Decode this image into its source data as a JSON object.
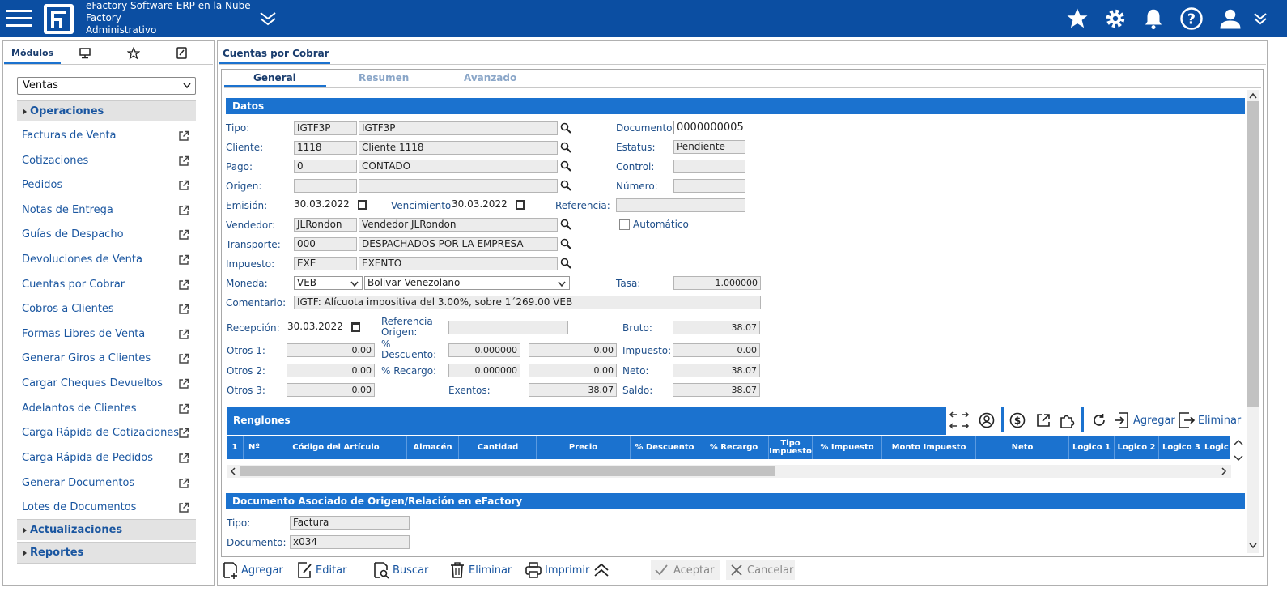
{
  "header": {
    "line1": "eFactory Software ERP en la Nube",
    "line2": "Factory",
    "line3": "Administrativo"
  },
  "sidebar": {
    "tabs": [
      "Módulos"
    ],
    "module_select": "Ventas",
    "sections": [
      "Operaciones",
      "Actualizaciones",
      "Reportes"
    ],
    "items": [
      "Facturas de Venta",
      "Cotizaciones",
      "Pedidos",
      "Notas de Entrega",
      "Guías de Despacho",
      "Devoluciones de Venta",
      "Cuentas por Cobrar",
      "Cobros a Clientes",
      "Formas Libres de Venta",
      "Generar Giros a Clientes",
      "Cargar Cheques Devueltos",
      "Adelantos de Clientes",
      "Carga Rápida de Cotizaciones",
      "Carga Rápida de Pedidos",
      "Generar Documentos",
      "Lotes de Documentos"
    ]
  },
  "main": {
    "window_tab": "Cuentas por Cobrar",
    "subtabs": [
      "General",
      "Resumen",
      "Avanzado"
    ],
    "datos": {
      "title": "Datos",
      "tipo_label": "Tipo:",
      "tipo_code": "IGTF3P",
      "tipo_name": "IGTF3P",
      "cliente_label": "Cliente:",
      "cliente_code": "1118",
      "cliente_name": "Cliente 1118",
      "pago_label": "Pago:",
      "pago_code": "0",
      "pago_name": "CONTADO",
      "origen_label": "Origen:",
      "origen_code": "",
      "origen_name": "",
      "emision_label": "Emisión:",
      "emision": "30.03.2022",
      "vencimiento_label": "Vencimiento:",
      "vencimiento": "30.03.2022",
      "referencia_label": "Referencia:",
      "referencia": "",
      "vendedor_label": "Vendedor:",
      "vendedor_code": "JLRondon",
      "vendedor_name": "Vendedor JLRondon",
      "transporte_label": "Transporte:",
      "transporte_code": "000",
      "transporte_name": "DESPACHADOS POR LA EMPRESA",
      "impuesto_label": "Impuesto:",
      "impuesto_code": "EXE",
      "impuesto_name": "EXENTO",
      "moneda_label": "Moneda:",
      "moneda_code": "VEB",
      "moneda_name": "Bolivar Venezolano",
      "comentario_label": "Comentario:",
      "comentario": "IGTF: Alícuota impositiva del 3.00%, sobre 1´269.00 VEB",
      "documento_label": "Documento:",
      "documento": "0000000005",
      "estatus_label": "Estatus:",
      "estatus": "Pendiente",
      "control_label": "Control:",
      "control": "",
      "numero_label": "Número:",
      "numero": "",
      "automatico_label": "Automático",
      "tasa_label": "Tasa:",
      "tasa": "1.000000",
      "recepcion_label": "Recepción:",
      "recepcion": "30.03.2022",
      "ref_origen_label1": "Referencia",
      "ref_origen_label2": "Origen:",
      "ref_origen": "",
      "otros1_label": "Otros 1:",
      "otros1": "0.00",
      "otros2_label": "Otros 2:",
      "otros2": "0.00",
      "otros3_label": "Otros 3:",
      "otros3": "0.00",
      "descuento_label1": "%",
      "descuento_label2": "Descuento:",
      "descuento_pct": "0.000000",
      "descuento_monto": "0.00",
      "recargo_label": "% Recargo:",
      "recargo_pct": "0.000000",
      "recargo_monto": "0.00",
      "exentos_label": "Exentos:",
      "exentos": "38.07",
      "bruto_label": "Bruto:",
      "bruto": "38.07",
      "impuesto_tot_label": "Impuesto:",
      "impuesto_tot": "0.00",
      "neto_label": "Neto:",
      "neto": "38.07",
      "saldo_label": "Saldo:",
      "saldo": "38.07"
    },
    "renglones": {
      "title": "Renglones",
      "agregar": "Agregar",
      "eliminar": "Eliminar",
      "columns": [
        "1",
        "Nº",
        "Código del Artículo",
        "Almacén",
        "Cantidad",
        "Precio",
        "% Descuento",
        "% Recargo",
        "Tipo Impuesto",
        "% Impuesto",
        "Monto Impuesto",
        "Neto",
        "Logico 1",
        "Logico 2",
        "Logico 3",
        "Logic"
      ]
    },
    "asociado": {
      "title": "Documento Asociado de Origen/Relación en eFactory",
      "tipo_label": "Tipo:",
      "tipo": "Factura",
      "documento_label": "Documento:",
      "documento": "x034"
    }
  },
  "toolbar": {
    "agregar": "Agregar",
    "editar": "Editar",
    "buscar": "Buscar",
    "eliminar": "Eliminar",
    "imprimir": "Imprimir",
    "aceptar": "Aceptar",
    "cancelar": "Cancelar"
  },
  "colors": {
    "topbar": "#0b4ea2",
    "section": "#1b72cf",
    "text": "#1f4f8a"
  }
}
